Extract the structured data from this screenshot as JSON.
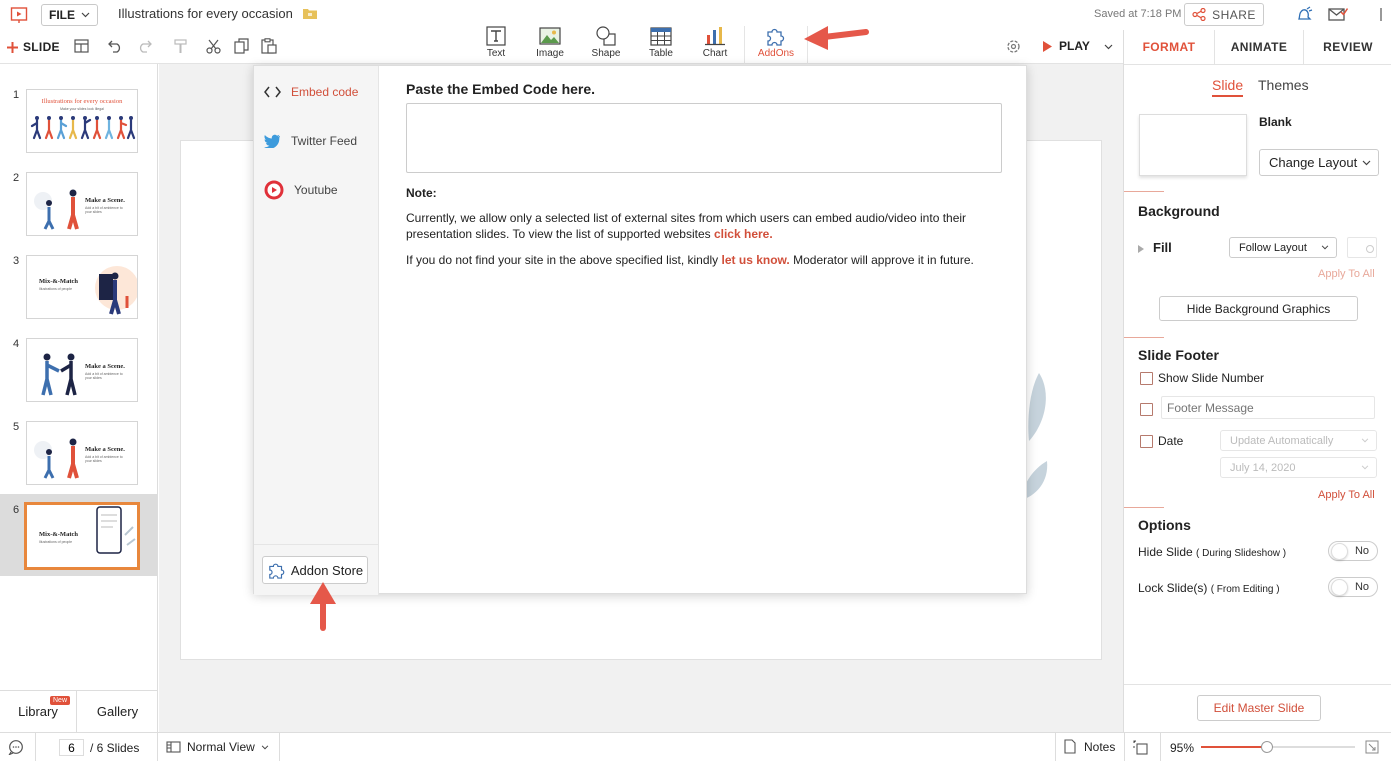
{
  "header": {
    "file_label": "FILE",
    "doc_title": "Illustrations for every occasion",
    "saved_status": "Saved at 7:18 PM",
    "share_label": "SHARE"
  },
  "toolbar": {
    "slide_label": "SLIDE",
    "insert": [
      "Text",
      "Image",
      "Shape",
      "Table",
      "Chart",
      "AddOns"
    ],
    "play_label": "PLAY"
  },
  "right_panel": {
    "tabs": [
      "FORMAT",
      "ANIMATE",
      "REVIEW"
    ],
    "subtabs": [
      "Slide",
      "Themes"
    ],
    "layout_name": "Blank",
    "change_layout": "Change Layout",
    "background": {
      "title": "Background",
      "fill_label": "Fill",
      "fill_value": "Follow Layout",
      "apply_all": "Apply To All",
      "hide_graphics": "Hide Background Graphics"
    },
    "footer": {
      "title": "Slide Footer",
      "show_number": "Show Slide Number",
      "footer_placeholder": "Footer Message",
      "date_label": "Date",
      "date_mode": "Update Automatically",
      "date_value": "July 14, 2020",
      "apply_all": "Apply To All"
    },
    "options": {
      "title": "Options",
      "hide_slide": "Hide Slide",
      "hide_slide_note": "( During Slideshow )",
      "lock_slide": "Lock Slide(s)",
      "lock_slide_note": "( From Editing )",
      "toggle_value": "No"
    },
    "edit_master": "Edit Master Slide"
  },
  "slides": [
    {
      "num": "1",
      "title": "Illustrations for every occasion",
      "subtitle": "Make your slides look Illegal"
    },
    {
      "num": "2",
      "title": "Make a Scene.",
      "subtitle": "Add a bit of ambience to your slides"
    },
    {
      "num": "3",
      "title": "Mix-&-Match",
      "subtitle": "Illustrations of people"
    },
    {
      "num": "4",
      "title": "Make a Scene.",
      "subtitle": "Add a bit of ambience to your slides"
    },
    {
      "num": "5",
      "title": "Make a Scene.",
      "subtitle": "Add a bit of ambience to your slides"
    },
    {
      "num": "6",
      "title": "Mix-&-Match",
      "subtitle": "Illustrations of people"
    }
  ],
  "left_bottom": {
    "library": "Library",
    "library_badge": "New",
    "gallery": "Gallery"
  },
  "dialog": {
    "side_items": [
      "Embed code",
      "Twitter Feed",
      "Youtube"
    ],
    "addon_store": "Addon Store",
    "heading": "Paste the Embed Code here.",
    "embed_value": "",
    "note_label": "Note:",
    "note_text_1": "Currently, we allow only a selected list of external sites from which users can embed audio/video into their presentation slides. To view the list of supported websites",
    "note_link_1": "click here.",
    "note_text_2": "If you do not find your site in the above specified list, kindly",
    "note_link_2": "let us know.",
    "note_text_3": "Moderator will approve it in future."
  },
  "statusbar": {
    "current_slide": "6",
    "total": "/ 6 Slides",
    "view_mode": "Normal View",
    "notes": "Notes",
    "zoom": "95%",
    "zoom_level": 0.95
  },
  "colors": {
    "accent": "#e0513a",
    "link": "#d14f3a",
    "selected_border": "#e8873c",
    "arrow": "#e5584a"
  }
}
